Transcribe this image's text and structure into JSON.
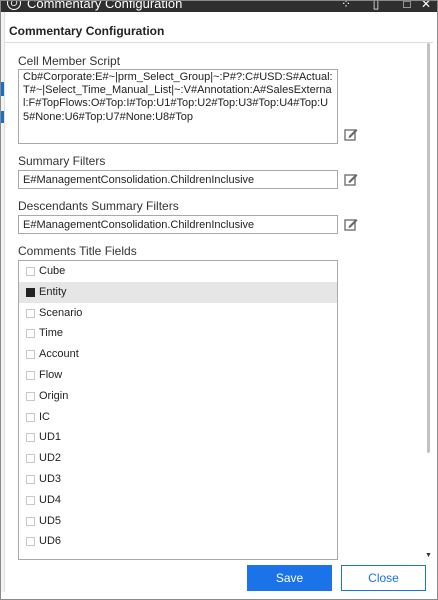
{
  "window": {
    "title": "Commentary Configuration"
  },
  "header": {
    "title": "Commentary Configuration"
  },
  "cell_member_script": {
    "label": "Cell Member Script",
    "value": "Cb#Corporate:E#~|prm_Select_Group|~:P#?:C#USD:S#Actual:T#~|Select_Time_Manual_List|~:V#Annotation:A#SalesExternal:F#TopFlows:O#Top:I#Top:U1#Top:U2#Top:U3#Top:U4#Top:U5#None:U6#Top:U7#None:U8#Top"
  },
  "summary_filters": {
    "label": "Summary Filters",
    "value": "E#ManagementConsolidation.ChildrenInclusive"
  },
  "descendants_summary_filters": {
    "label": "Descendants Summary Filters",
    "value": "E#ManagementConsolidation.ChildrenInclusive"
  },
  "comments_title_fields": {
    "label": "Comments Title Fields",
    "items": [
      {
        "label": "Cube",
        "checked": false
      },
      {
        "label": "Entity",
        "checked": true
      },
      {
        "label": "Scenario",
        "checked": false
      },
      {
        "label": "Time",
        "checked": false
      },
      {
        "label": "Account",
        "checked": false
      },
      {
        "label": "Flow",
        "checked": false
      },
      {
        "label": "Origin",
        "checked": false
      },
      {
        "label": "IC",
        "checked": false
      },
      {
        "label": "UD1",
        "checked": false
      },
      {
        "label": "UD2",
        "checked": false
      },
      {
        "label": "UD3",
        "checked": false
      },
      {
        "label": "UD4",
        "checked": false
      },
      {
        "label": "UD5",
        "checked": false
      },
      {
        "label": "UD6",
        "checked": false
      }
    ]
  },
  "footer": {
    "save_label": "Save",
    "close_label": "Close"
  },
  "colors": {
    "accent": "#1a73e8",
    "titlebar": "#2f2f2f"
  }
}
